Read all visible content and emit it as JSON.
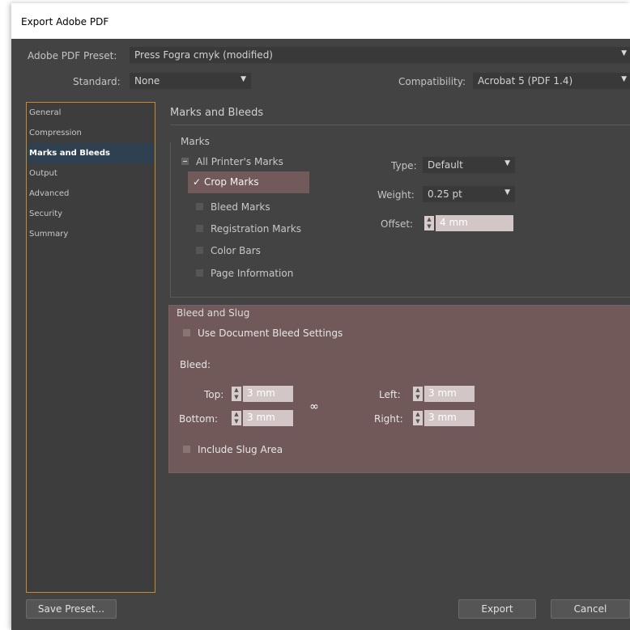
{
  "window": {
    "title": "Export Adobe PDF"
  },
  "preset": {
    "label": "Adobe PDF Preset:",
    "value": "Press Fogra cmyk (modified)"
  },
  "standard": {
    "label": "Standard:",
    "value": "None"
  },
  "compatibility": {
    "label": "Compatibility:",
    "value": "Acrobat 5 (PDF 1.4)"
  },
  "sidebar": {
    "items": [
      {
        "label": "General"
      },
      {
        "label": "Compression"
      },
      {
        "label": "Marks and Bleeds"
      },
      {
        "label": "Output"
      },
      {
        "label": "Advanced"
      },
      {
        "label": "Security"
      },
      {
        "label": "Summary"
      }
    ],
    "active_index": 2
  },
  "section": {
    "title": "Marks and Bleeds"
  },
  "marks": {
    "group_label": "Marks",
    "all_printers_marks": "All Printer's Marks",
    "crop_marks": {
      "label": "Crop Marks",
      "checked": true
    },
    "bleed_marks": {
      "label": "Bleed Marks",
      "checked": false
    },
    "registration_marks": {
      "label": "Registration Marks",
      "checked": false
    },
    "color_bars": {
      "label": "Color Bars",
      "checked": false
    },
    "page_information": {
      "label": "Page Information",
      "checked": false
    },
    "type": {
      "label": "Type:",
      "value": "Default"
    },
    "weight": {
      "label": "Weight:",
      "value": "0.25 pt"
    },
    "offset": {
      "label": "Offset:",
      "value": "4 mm"
    }
  },
  "bleed": {
    "group_label": "Bleed and Slug",
    "use_document": {
      "label": "Use Document Bleed Settings",
      "checked": false
    },
    "bleed_label": "Bleed:",
    "top": {
      "label": "Top:",
      "value": "3 mm"
    },
    "bottom": {
      "label": "Bottom:",
      "value": "3 mm"
    },
    "left": {
      "label": "Left:",
      "value": "3 mm"
    },
    "right": {
      "label": "Right:",
      "value": "3 mm"
    },
    "include_slug": {
      "label": "Include Slug Area",
      "checked": false
    }
  },
  "buttons": {
    "save_preset": "Save Preset...",
    "export": "Export",
    "cancel": "Cancel"
  },
  "colors": {
    "dialog_bg": "#434343",
    "sidebar_border": "#c58a2a",
    "active_item": "#2f4050",
    "highlight": "#725959"
  }
}
